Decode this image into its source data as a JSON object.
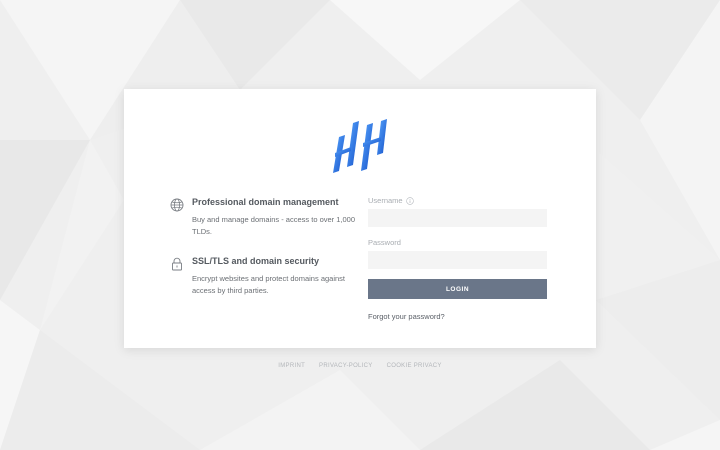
{
  "login": {
    "username_label": "Username",
    "username_value": "",
    "password_label": "Password",
    "password_value": "",
    "login_button": "LOGIN",
    "forgot_link": "Forgot your password?"
  },
  "features": [
    {
      "icon": "globe-icon",
      "title": "Professional domain management",
      "description": "Buy and manage domains - access to over 1,000 TLDs."
    },
    {
      "icon": "lock-icon",
      "title": "SSL/TLS and domain security",
      "description": "Encrypt websites and protect domains against access by third parties."
    }
  ],
  "footer": {
    "links": [
      "IMPRINT",
      "PRIVACY-POLICY",
      "COOKIE PRIVACY"
    ]
  },
  "colors": {
    "brand_blue": "#1f6fe0",
    "button": "#6a7689",
    "background": "#efefef"
  }
}
